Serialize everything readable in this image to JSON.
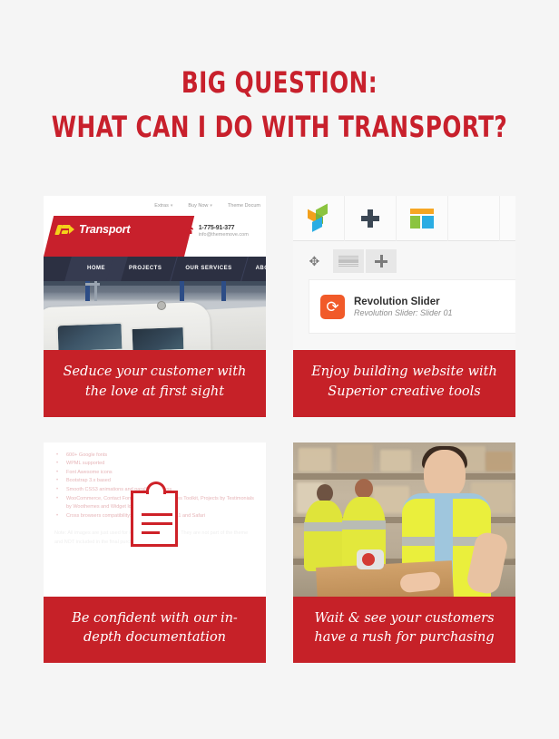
{
  "heading": {
    "line1": "Big Question:",
    "line2": "What can I do with Transport?",
    "color": "#c8202c"
  },
  "theme": {
    "background": "#f5f5f5",
    "accent_red": "#c62128",
    "nav_dark": "#2c3042",
    "logo_yellow": "#f4d11a"
  },
  "cards": [
    {
      "id": "card-seduce",
      "caption": "Seduce your customer with the love at first sight",
      "media_type": "website-mockup"
    },
    {
      "id": "card-builder",
      "caption": "Enjoy building website with Superior creative tools",
      "media_type": "page-builder-mockup"
    },
    {
      "id": "card-docs",
      "caption": "Be confident with our in-depth documentation",
      "media_type": "documentation-mockup"
    },
    {
      "id": "card-warehouse",
      "caption": "Wait & see your customers have a rush for purchasing",
      "media_type": "warehouse-photo"
    }
  ],
  "site_mockup": {
    "topbar_links": [
      "Extras",
      "Buy Now",
      "Theme Docum"
    ],
    "logo_text": "Transport",
    "phone": "1-775-91-377",
    "email": "info@thememove.com",
    "nav": [
      "HOME",
      "PROJECTS",
      "OUR SERVICES",
      "ABOUT US"
    ],
    "nav_active": "HOME"
  },
  "builder_mockup": {
    "toolbar_icons": [
      "visual-composer-cube-icon",
      "plus-icon",
      "layout-grid-icon"
    ],
    "row_tools": [
      "move-icon",
      "rows-icon",
      "plus-icon"
    ],
    "element_title": "Revolution Slider",
    "element_subtitle": "Revolution Slider: Slider 01",
    "element_icon": "revolution-slider-icon",
    "element_icon_color": "#f15a29"
  },
  "docs_mockup": {
    "items": [
      "600+ Google fonts",
      "WPML supported",
      "Font Awesome icons",
      "Bootstrap 3.x based",
      "Smooth CSS3 animations and parallax sections",
      "WooCommerce, Contact Form 7, Envato WordPress Toolkit, Projects by Testimonials by Woothemes and Widget logic supported",
      "Cross browsers compatibility: Chrome, Firefox, IE11 and Safari"
    ],
    "note": "Note: All images are just used for Preview Purpose Only. They are not part of the theme and NOT included in the final purchase files.",
    "icon": "clipboard-icon"
  }
}
